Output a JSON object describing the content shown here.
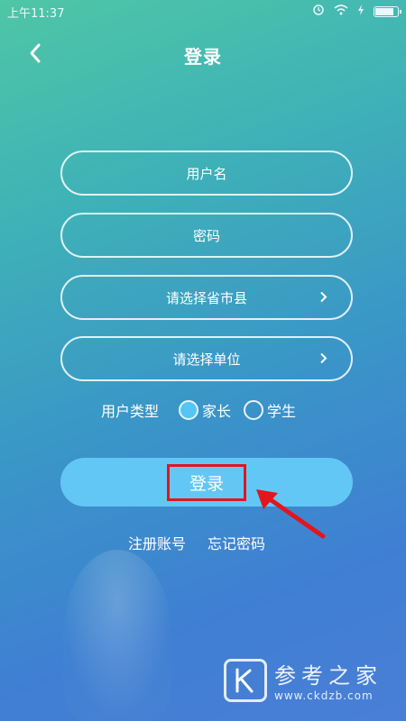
{
  "status_bar": {
    "time": "上午11:37"
  },
  "header": {
    "title": "登录"
  },
  "form": {
    "username_placeholder": "用户名",
    "password_placeholder": "密码",
    "region_placeholder": "请选择省市县",
    "unit_placeholder": "请选择单位",
    "user_type_label": "用户类型",
    "user_types": [
      {
        "label": "家长",
        "selected": true
      },
      {
        "label": "学生",
        "selected": false
      }
    ]
  },
  "actions": {
    "login_label": "登录",
    "register_label": "注册账号",
    "forgot_label": "忘记密码"
  },
  "watermark": {
    "name": "参考之家",
    "url": "www.ckdzb.com"
  },
  "colors": {
    "login_button": "#63c7f6",
    "annotation": "#e3151d"
  }
}
